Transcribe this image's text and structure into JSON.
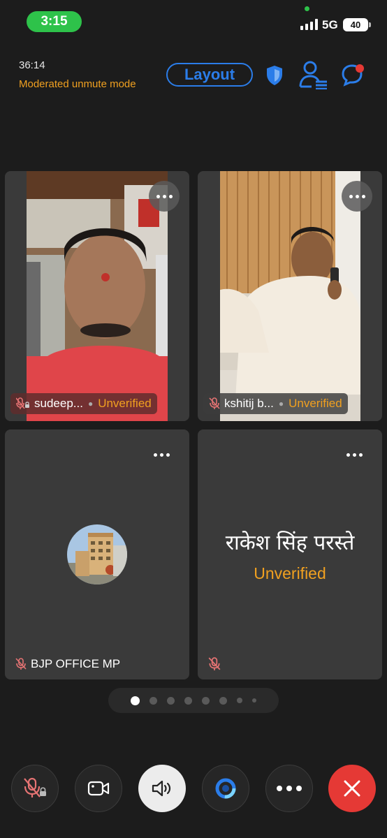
{
  "status_bar": {
    "time": "3:15",
    "network": "5G",
    "battery": "40"
  },
  "meeting": {
    "timer": "36:14",
    "mode": "Moderated unmute mode",
    "layout_label": "Layout"
  },
  "colors": {
    "accent_blue": "#2b7de9",
    "warning_orange": "#f0a020",
    "end_red": "#e53935",
    "status_green": "#2ec24a",
    "tile_bg": "#3a3a3a"
  },
  "participants": [
    {
      "name": "sudeep...",
      "status": "Unverified",
      "mic": "muted-locked"
    },
    {
      "name": "kshitij b...",
      "status": "Unverified",
      "mic": "muted"
    },
    {
      "name": "BJP OFFICE MP",
      "mic": "muted"
    },
    {
      "name": "राकेश सिंह परस्ते",
      "status": "Unverified",
      "mic": "muted"
    }
  ],
  "pager": {
    "current_page": 1,
    "total_dots": 8
  },
  "controls": [
    {
      "icon": "mic-off-locked-icon"
    },
    {
      "icon": "video-camera-icon"
    },
    {
      "icon": "speaker-icon"
    },
    {
      "icon": "share-icon"
    },
    {
      "icon": "more-icon"
    },
    {
      "icon": "close-icon"
    }
  ]
}
